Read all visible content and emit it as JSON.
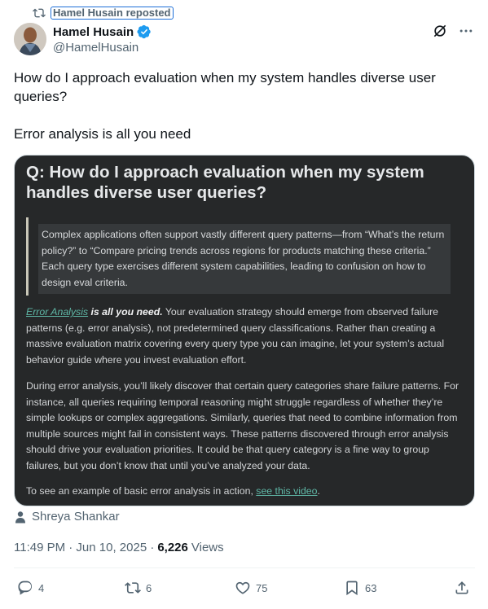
{
  "repost": {
    "label": "Hamel Husain reposted"
  },
  "author": {
    "name": "Hamel Husain",
    "handle": "@HamelHusain"
  },
  "tweet": {
    "line1": "How do I approach evaluation when my system handles diverse user queries?",
    "line2": "Error analysis is all you need"
  },
  "image": {
    "title": "Q: How do I approach evaluation when my system handles diverse user queries?",
    "quote": "Complex applications often support vastly different query patterns—from “What’s the return policy?” to “Compare pricing trends across regions for products matching these criteria.” Each query type exercises different system capabilities, leading to confusion on how to design eval criteria.",
    "p1_link": "Error Analysis",
    "p1_bold": " is all you need.",
    "p1_rest": " Your evaluation strategy should emerge from observed failure patterns (e.g. error analysis), not predetermined query classifications. Rather than creating a massive evaluation matrix covering every query type you can imagine, let your system’s actual behavior guide where you invest evaluation effort.",
    "p2": "During error analysis, you’ll likely discover that certain query categories share failure patterns. For instance, all queries requiring temporal reasoning might struggle regardless of whether they’re simple lookups or complex aggregations. Similarly, queries that need to combine information from multiple sources might fail in consistent ways. These patterns discovered through error analysis should drive your evaluation priorities. It could be that query category is a fine way to group failures, but you don’t know that until you’ve analyzed your data.",
    "p3_text": "To see an example of basic error analysis in action, ",
    "p3_link": "see this video",
    "p3_end": "."
  },
  "source": {
    "name": "Shreya Shankar"
  },
  "meta": {
    "time": "11:49 PM · Jun 10, 2025 ·",
    "views_count": "6,226",
    "views_label": "Views"
  },
  "actions": {
    "replies": "4",
    "reposts": "6",
    "likes": "75",
    "bookmarks": "63"
  },
  "colors": {
    "accent": "#1d9bf0",
    "muted": "#536471",
    "card_bg": "#262829",
    "link": "#5fb7a6"
  },
  "icons": [
    "repost-icon",
    "verified-icon",
    "grok-icon",
    "more-icon",
    "person-icon",
    "reply-icon",
    "like-icon",
    "bookmark-icon",
    "share-icon"
  ]
}
